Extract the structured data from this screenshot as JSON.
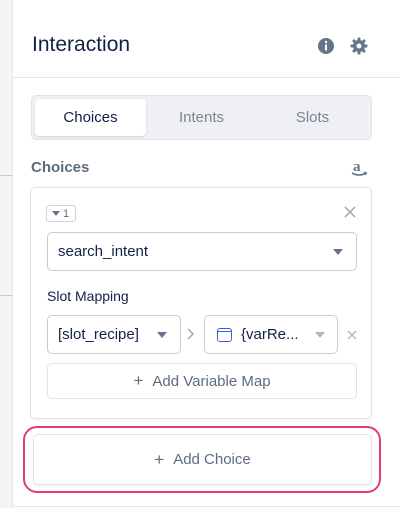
{
  "panel": {
    "title": "Interaction"
  },
  "tabs": [
    {
      "label": "Choices",
      "active": true
    },
    {
      "label": "Intents",
      "active": false
    },
    {
      "label": "Slots",
      "active": false
    }
  ],
  "choices_section": {
    "label": "Choices"
  },
  "choice": {
    "index": "1",
    "intent_value": "search_intent",
    "slot_mapping_label": "Slot Mapping",
    "slot_value": "[slot_recipe]",
    "variable_value": "{varRe...",
    "add_variable_map_label": "Add Variable Map"
  },
  "add_choice_label": "Add Choice",
  "colors": {
    "highlight": "#e03f6f",
    "variable_icon": "#3e5fd6",
    "title": "#132144",
    "muted": "#5d6c80"
  },
  "icons": {
    "info": "info-icon",
    "settings": "gear-icon",
    "platform": "amazon-icon",
    "remove": "close-icon",
    "variable": "variable-icon"
  }
}
